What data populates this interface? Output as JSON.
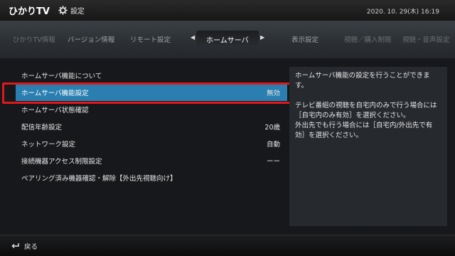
{
  "header": {
    "logo": "ひかりTV",
    "title": "設定",
    "datetime": "2020. 10. 29(木)  16:19",
    "settings_icon": "gear-icon"
  },
  "tabs": {
    "items": [
      {
        "label": "ひかりTV情報",
        "state": "faded"
      },
      {
        "label": "バージョン情報",
        "state": "normal"
      },
      {
        "label": "リモート設定",
        "state": "normal"
      },
      {
        "label": "ホームサーバ",
        "state": "active"
      },
      {
        "label": "表示設定",
        "state": "normal"
      },
      {
        "label": "視聴／購入制限",
        "state": "faded"
      },
      {
        "label": "視聴・音声設定",
        "state": "faded"
      }
    ],
    "left_arrow": "◀",
    "right_arrow": "▶"
  },
  "menu": {
    "items": [
      {
        "label": "ホームサーバ機能について",
        "value": ""
      },
      {
        "label": "ホームサーバ機能設定",
        "value": "無効",
        "selected": true
      },
      {
        "label": "ホームサーバ状態確認",
        "value": ""
      },
      {
        "label": "配信年齢設定",
        "value": "20歳"
      },
      {
        "label": "ネットワーク設定",
        "value": "自動"
      },
      {
        "label": "接続機器アクセス制限設定",
        "value": "ーー"
      },
      {
        "label": "ペアリング済み機器確認・解除【外出先視聴向け】",
        "value": ""
      }
    ]
  },
  "description": {
    "para1": "ホームサーバ機能の設定を行うことができます。",
    "para2_line1": "テレビ番組の視聴を自宅内のみで行う場合には［自宅内のみ有効］を選択ください。",
    "para2_line2": "外出先でも行う場合には［自宅内/外出先で有効］を選択ください。"
  },
  "footer": {
    "back_label": "戻る",
    "back_icon": "return-arrow-icon"
  },
  "colors": {
    "selected_bg": "#2a7fb0",
    "highlight_frame": "#e0181b",
    "panel_bg": "#262a2e"
  }
}
